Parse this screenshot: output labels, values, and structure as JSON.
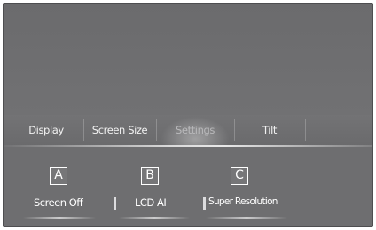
{
  "tabs": [
    {
      "label": "Display",
      "selected": false
    },
    {
      "label": "Screen Size",
      "selected": false
    },
    {
      "label": "Settings",
      "selected": true
    },
    {
      "label": "Tilt",
      "selected": false
    }
  ],
  "buttons": {
    "screen_off": {
      "label": "Screen Off",
      "callout": "A"
    },
    "lcd_ai": {
      "label": "LCD AI",
      "callout": "B"
    },
    "super_resolution": {
      "label": "Super Resolution",
      "callout": "C"
    }
  }
}
